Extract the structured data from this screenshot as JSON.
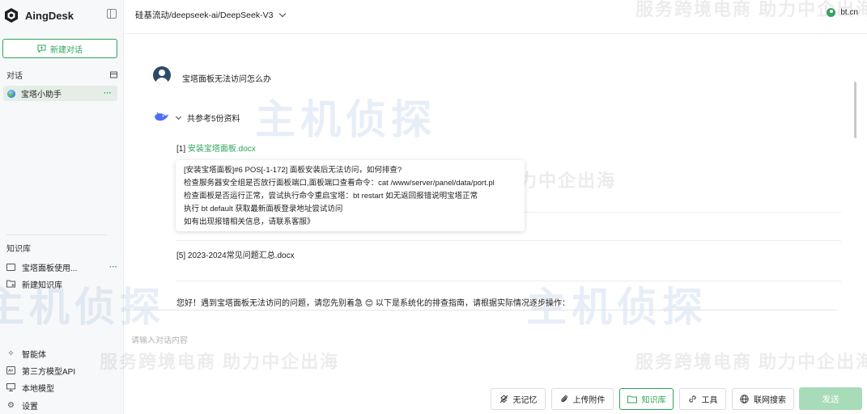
{
  "app": {
    "name": "AingDesk"
  },
  "sidebar": {
    "new_chat_label": "新建对话",
    "chats_section_label": "对话",
    "chats": [
      {
        "label": "宝塔小助手",
        "more": "···"
      }
    ],
    "kb_section_label": "知识库",
    "kb_items": [
      {
        "label": "宝塔面板使用...",
        "more": "···"
      },
      {
        "label": "新建知识库"
      }
    ],
    "nav": [
      {
        "label": "智能体",
        "icon": "agent-icon"
      },
      {
        "label": "第三方模型API",
        "icon": "api-icon"
      },
      {
        "label": "本地模型",
        "icon": "monitor-icon"
      },
      {
        "label": "设置",
        "icon": "gear-icon"
      }
    ]
  },
  "header": {
    "model": "硅基流动/deepseek-ai/DeepSeek-V3",
    "user": "bt.cn"
  },
  "chat": {
    "user_message": "宝塔面板无法访问怎么办",
    "refs_toggle": "共参考5份资料",
    "ref1_index": "[1] ",
    "ref1_link": "安装宝塔面板.docx",
    "ref5": "[5] 2023-2024常见问题汇总.docx",
    "tooltip_lines": [
      "[安装宝塔面板]#6 POS[-1-172] 面板安装后无法访问，如何排查?",
      "检查服务器安全组是否放行面板端口,面板端口查看命令：cat /www/server/panel/data/port.pl",
      "检查面板是否运行正常，尝试执行命令重启宝塔：bt restart 如无返回报错说明宝塔正常",
      "执行 bt default 获取最新面板登录地址尝试访问",
      "如有出现报错相关信息，请联系客服》"
    ],
    "answer_intro": "您好！遇到宝塔面板无法访问的问题，请您先别着急 😊 以下是系统化的排查指南，请根据实际情况逐步操作："
  },
  "input": {
    "placeholder": "请输入对话内容",
    "value": ""
  },
  "toolbar": {
    "no_memory": "无记忆",
    "upload": "上传附件",
    "knowledge_base": "知识库",
    "tools": "工具",
    "web_search": "联网搜索",
    "send": "发送"
  },
  "watermark": {
    "brand": "主机侦探",
    "slogan": "服务跨境电商 助力中企出海"
  },
  "colors": {
    "accent": "#2fa55a",
    "send_disabled": "#a8dcb9",
    "sidebar_bg": "#f7f8fa",
    "active_item_bg": "#e4eee7"
  }
}
